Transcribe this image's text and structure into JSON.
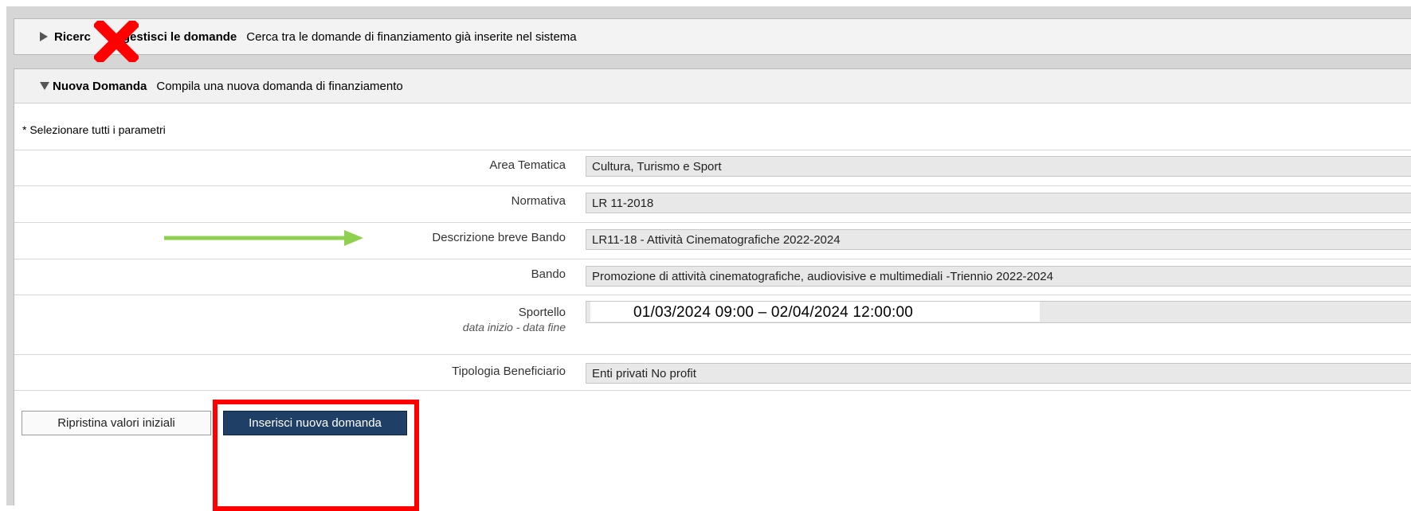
{
  "search_panel": {
    "title": "Ricerca e gestisci le domande",
    "title_visible_start": "Ricerc",
    "title_visible_end": "gestisci le domande",
    "description": "Cerca tra le domande di finanziamento già inserite nel sistema",
    "icon": "triangle-right-icon",
    "overlay_icon": "red-x-icon"
  },
  "new_panel": {
    "title": "Nuova Domanda",
    "description": "Compila una nuova domanda di finanziamento",
    "icon": "triangle-down-icon"
  },
  "form": {
    "required_note": "* Selezionare tutti i parametri",
    "fields": [
      {
        "label": "Area Tematica",
        "value": "Cultura, Turismo e Sport"
      },
      {
        "label": "Normativa",
        "value": "LR 11-2018"
      },
      {
        "label": "Descrizione breve Bando",
        "value": "LR11-18 - Attività Cinematografiche 2022-2024"
      },
      {
        "label": "Bando",
        "value": "Promozione di attività cinematografiche, audiovisive e multimediali -Triennio 2022-2024"
      },
      {
        "label": "Sportello",
        "sublabel": "data inizio - data fine",
        "value": "01/03/2024 09:00 – 02/04/2024  12:00:00"
      },
      {
        "label": "Tipologia Beneficiario",
        "value": "Enti privati No profit"
      }
    ]
  },
  "buttons": {
    "reset": "Ripristina valori iniziali",
    "insert": "Inserisci nuova domanda"
  },
  "annotations": {
    "arrow_color": "#8fd14f",
    "highlight_color": "#ff0000",
    "x_color": "#ff0000"
  }
}
